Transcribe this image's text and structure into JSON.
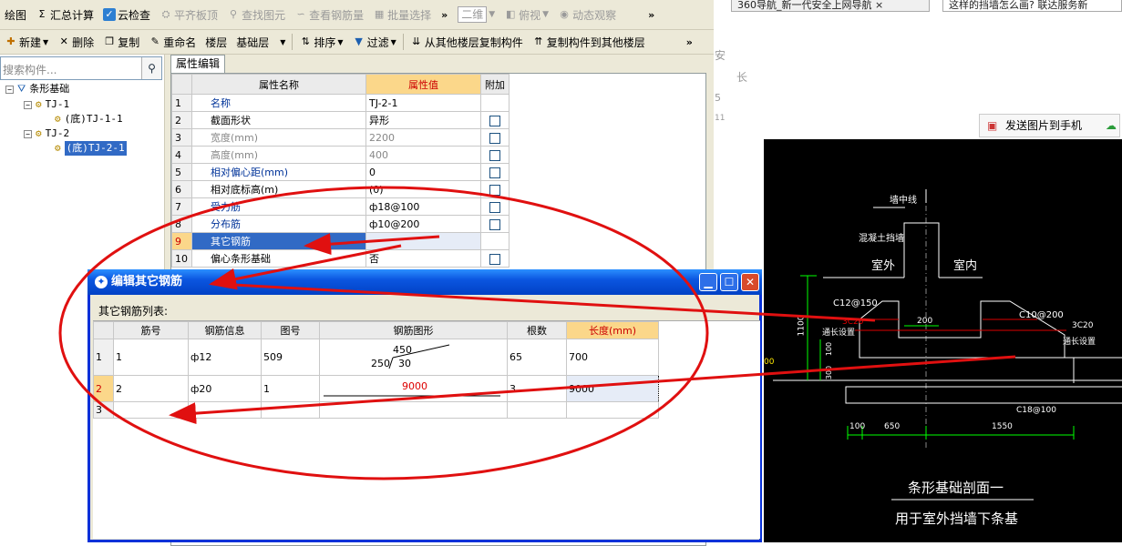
{
  "toolbar1": {
    "items": [
      "绘图",
      "汇总计算",
      "云检查",
      "平齐板顶",
      "查找图元",
      "查看钢筋量",
      "批量选择"
    ],
    "view_select": "二维",
    "view_items": [
      "俯视",
      "动态观察"
    ]
  },
  "toolbar2": {
    "items": [
      "新建",
      "删除",
      "复制",
      "重命名"
    ],
    "floor_label": "楼层",
    "floor_value": "基础层",
    "sort": "排序",
    "filter": "过滤",
    "copy_from": "从其他楼层复制构件",
    "copy_to": "复制构件到其他楼层"
  },
  "search": {
    "placeholder": "搜索构件..."
  },
  "tree": {
    "root": "条形基础",
    "nodes": [
      "TJ-1",
      "(底)TJ-1-1",
      "TJ-2",
      "(底)TJ-2-1"
    ]
  },
  "props": {
    "tab": "属性编辑",
    "headers": [
      "属性名称",
      "属性值",
      "附加"
    ],
    "rows": [
      {
        "n": "1",
        "name": "名称",
        "value": "TJ-2-1"
      },
      {
        "n": "2",
        "name": "截面形状",
        "value": "异形"
      },
      {
        "n": "3",
        "name": "宽度(mm)",
        "value": "2200"
      },
      {
        "n": "4",
        "name": "高度(mm)",
        "value": "400"
      },
      {
        "n": "5",
        "name": "相对偏心距(mm)",
        "value": "0"
      },
      {
        "n": "6",
        "name": "相对底标高(m)",
        "value": "(0)"
      },
      {
        "n": "7",
        "name": "受力筋",
        "value": "ф18@100"
      },
      {
        "n": "8",
        "name": "分布筋",
        "value": "ф10@200"
      },
      {
        "n": "9",
        "name": "其它钢筋",
        "value": ""
      },
      {
        "n": "10",
        "name": "偏心条形基础",
        "value": "否"
      }
    ]
  },
  "dialog": {
    "title": "编辑其它钢筋",
    "list_label": "其它钢筋列表:",
    "headers": [
      "筋号",
      "钢筋信息",
      "图号",
      "钢筋图形",
      "根数",
      "长度(mm)"
    ],
    "rows": [
      {
        "n": "1",
        "no": "1",
        "info": "ф12",
        "fig": "509",
        "shape_a": "450",
        "shape_b": "250",
        "shape_c": "30",
        "count": "65",
        "len": "700"
      },
      {
        "n": "2",
        "no": "2",
        "info": "ф20",
        "fig": "1",
        "shape_a": "9000",
        "count": "3",
        "len": "9000"
      },
      {
        "n": "3"
      }
    ]
  },
  "browser": {
    "tab1": "360导航_新一代安全上网导航",
    "tab2": "这样的挡墙怎么画? 联达服务新",
    "frag1": "安",
    "frag2": "长",
    "frag3": "5",
    "frag4": "11",
    "send_button": "发送图片到手机"
  },
  "cad": {
    "wall_center": "墙中线",
    "retaining_wall": "混凝土挡墙",
    "outside": "室外",
    "inside": "室内",
    "c12": "C12@150",
    "c10": "C10@200",
    "c18": "C18@100",
    "bars_left": "3C20",
    "bars_right": "3C20",
    "through_left": "通长设置",
    "through_right": "通长设置",
    "d200": "200",
    "d1100": "1100",
    "d100v": "100",
    "d300": "300",
    "d100": "100",
    "d650": "650",
    "d1550": "1550",
    "cut_left": "00",
    "title": "条形基础剖面一",
    "subtitle": "用于室外挡墙下条基"
  }
}
